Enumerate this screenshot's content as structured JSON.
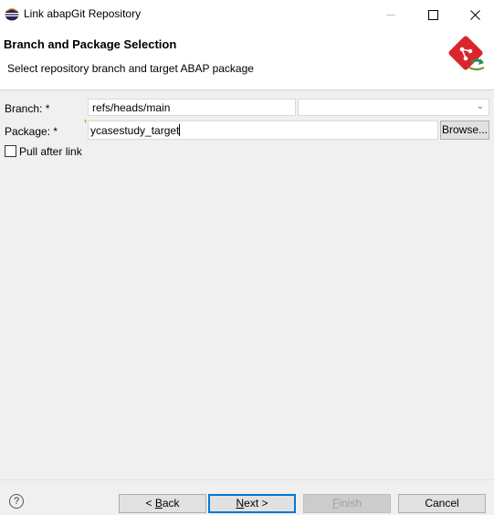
{
  "window": {
    "title": "Link abapGit Repository",
    "title_icon": "eclipse-icon"
  },
  "banner": {
    "title": "Branch and Package Selection",
    "description": "Select repository branch and target ABAP package",
    "icon": "git-link-icon"
  },
  "form": {
    "branch_label": "Branch: *",
    "branch_value": "refs/heads/main",
    "package_label": "Package: *",
    "package_value": "ycasestudy_target",
    "browse_label": "Browse...",
    "pull_after_link_label": "Pull after link",
    "pull_after_link_checked": false
  },
  "footer": {
    "back_prefix": "< ",
    "back_mnemonic": "B",
    "back_rest": "ack",
    "next_mnemonic": "N",
    "next_rest": "ext >",
    "finish_mnemonic": "F",
    "finish_rest": "inish",
    "cancel_label": "Cancel"
  },
  "colors": {
    "accent": "#0078d7",
    "git_red": "#d9262c",
    "git_green": "#2e8b57"
  }
}
